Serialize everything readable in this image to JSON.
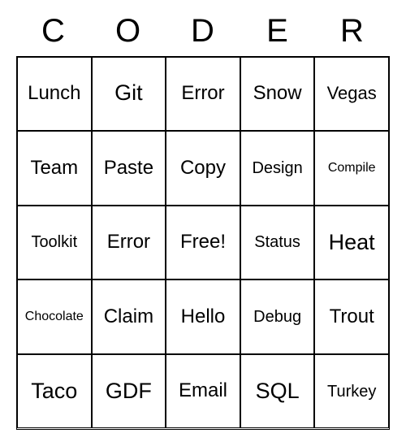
{
  "header": [
    "C",
    "O",
    "D",
    "E",
    "R"
  ],
  "cells": [
    {
      "text": "Lunch",
      "size": "lg"
    },
    {
      "text": "Git",
      "size": "xl"
    },
    {
      "text": "Error",
      "size": "lg"
    },
    {
      "text": "Snow",
      "size": "lg"
    },
    {
      "text": "Vegas",
      "size": "md"
    },
    {
      "text": "Team",
      "size": "lg"
    },
    {
      "text": "Paste",
      "size": "lg"
    },
    {
      "text": "Copy",
      "size": "lg"
    },
    {
      "text": "Design",
      "size": "sm"
    },
    {
      "text": "Compile",
      "size": "xs"
    },
    {
      "text": "Toolkit",
      "size": "sm"
    },
    {
      "text": "Error",
      "size": "lg"
    },
    {
      "text": "Free!",
      "size": "lg"
    },
    {
      "text": "Status",
      "size": "sm"
    },
    {
      "text": "Heat",
      "size": "xl"
    },
    {
      "text": "Chocolate",
      "size": "xs"
    },
    {
      "text": "Claim",
      "size": "lg"
    },
    {
      "text": "Hello",
      "size": "lg"
    },
    {
      "text": "Debug",
      "size": "sm"
    },
    {
      "text": "Trout",
      "size": "lg"
    },
    {
      "text": "Taco",
      "size": "xl"
    },
    {
      "text": "GDF",
      "size": "xl"
    },
    {
      "text": "Email",
      "size": "lg"
    },
    {
      "text": "SQL",
      "size": "xl"
    },
    {
      "text": "Turkey",
      "size": "sm"
    }
  ]
}
